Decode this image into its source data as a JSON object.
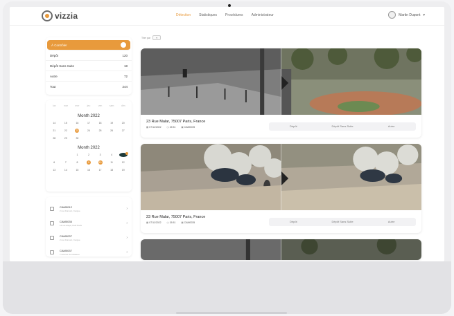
{
  "app": {
    "logo_text": "vizzia",
    "logo_icon": "vizzia-logo-icon"
  },
  "nav": [
    {
      "label": "Détection",
      "active": true
    },
    {
      "label": "Statistiques",
      "active": false
    },
    {
      "label": "Procédures",
      "active": false
    },
    {
      "label": "Administrateur",
      "active": false
    }
  ],
  "user": {
    "name": "Martin Dupont",
    "chevron": "▾"
  },
  "filters": [
    {
      "label": "À Contrôler",
      "count": "",
      "active": true
    },
    {
      "label": "Dépôt",
      "count": "120",
      "active": false
    },
    {
      "label": "Dépôt Sans Suite",
      "count": "18",
      "active": false
    },
    {
      "label": "Autre",
      "count": "72",
      "active": false
    },
    {
      "label": "Tout",
      "count": "244",
      "active": false
    }
  ],
  "calendar": {
    "weekdays": [
      "lun",
      "mar",
      "mer",
      "jeu",
      "ven",
      "sam",
      "dim"
    ],
    "months": [
      {
        "title": "Month 2022",
        "days": [
          "14",
          "15",
          "16",
          "17",
          "18",
          "19",
          "20",
          "21",
          "22",
          "23",
          "24",
          "25",
          "26",
          "27",
          "28",
          "29",
          "30",
          "",
          "",
          "",
          ""
        ],
        "marked": [
          "23"
        ]
      },
      {
        "title": "Month 2022",
        "days": [
          "",
          "",
          "1",
          "2",
          "3",
          "4",
          "5",
          "6",
          "7",
          "8",
          "9",
          "10",
          "11",
          "12",
          "13",
          "14",
          "15",
          "16",
          "17",
          "18",
          "19"
        ],
        "marked": [
          "9",
          "10"
        ],
        "selected": "5"
      }
    ]
  },
  "cameras": [
    {
      "name": "CAM0012",
      "sub": "2 rue Dumont, Cergue",
      "arrow": "›"
    },
    {
      "name": "CAM0035",
      "sub": "12 rue Alaya, Petit Paris",
      "arrow": "›"
    },
    {
      "name": "CAM0037",
      "sub": "2 rue Dumont, Cergue",
      "arrow": "›"
    },
    {
      "name": "CAM0037",
      "sub": "7 avenue du Château",
      "arrow": "›"
    }
  ],
  "sort": {
    "label": "Trier par",
    "value": "▾"
  },
  "events": [
    {
      "address": "23 Rue Malar, 75007 Paris, France",
      "date": "07/11/2022",
      "time": "15:51",
      "camera": "CAM0035",
      "actions": [
        "Dépôt",
        "Dépôt Sans Suite",
        "Autre"
      ]
    },
    {
      "address": "23 Rue Malar, 75007 Paris, France",
      "date": "07/11/2022",
      "time": "15:51",
      "camera": "CAM0035",
      "actions": [
        "Dépôt",
        "Dépôt Sans Suite",
        "Autre"
      ]
    }
  ],
  "colors": {
    "accent": "#e89a3c",
    "text": "#333333",
    "muted": "#888888"
  }
}
